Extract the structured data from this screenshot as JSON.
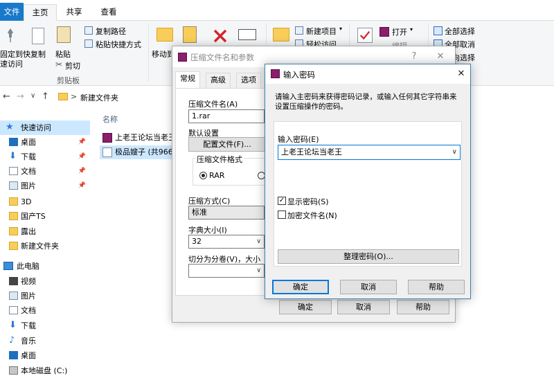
{
  "ribbon_tabs": {
    "file": "文件",
    "home": "主页",
    "share": "共享",
    "view": "查看"
  },
  "ribbon": {
    "pin_quick_access_line1": "固定到快",
    "pin_quick_access_line2": "速访问",
    "copy": "复制",
    "paste": "粘贴",
    "copy_path": "复制路径",
    "paste_shortcut": "粘贴快捷方式",
    "cut": "剪切",
    "clipboard_group": "剪贴板",
    "move_to": "移动到",
    "new_item": "新建项目",
    "easy_access": "轻松访问",
    "open": "打开",
    "edit": "编辑",
    "select_all": "全部选择",
    "select_none": "全部取消",
    "invert_selection": "反向选择"
  },
  "address": {
    "back": "←",
    "forward": "→",
    "dropdown": "∨",
    "up": "↑",
    "separator": ">",
    "path": "新建文件夹"
  },
  "nav": {
    "quick_access": "快速访问",
    "items": [
      {
        "label": "桌面"
      },
      {
        "label": "下载"
      },
      {
        "label": "文档"
      },
      {
        "label": "图片"
      },
      {
        "label": "3D"
      },
      {
        "label": "国产TS"
      },
      {
        "label": "露出"
      },
      {
        "label": "新建文件夹"
      }
    ],
    "this_pc": "此电脑",
    "pc_items": [
      {
        "label": "视频"
      },
      {
        "label": "图片"
      },
      {
        "label": "文档"
      },
      {
        "label": "下载"
      },
      {
        "label": "音乐"
      },
      {
        "label": "桌面"
      },
      {
        "label": "本地磁盘 (C:)"
      }
    ]
  },
  "files": {
    "column_name": "名称",
    "rows": [
      {
        "name": "上老王论坛当老王"
      },
      {
        "name": "极品嫂子 (共9663"
      }
    ]
  },
  "archive_dialog": {
    "title": "压缩文件名和参数",
    "help_icon": "?",
    "close_icon": "✕",
    "tabs": [
      "常规",
      "高级",
      "选项"
    ],
    "archive_name_label": "压缩文件名(A)",
    "archive_name_value": "1.rar",
    "default_settings_label": "默认设置",
    "profiles_button": "配置文件(F)...",
    "format_label": "压缩文件格式",
    "format_rar": "RAR",
    "method_label": "压缩方式(C)",
    "method_value": "标准",
    "dict_label": "字典大小(I)",
    "dict_value": "32",
    "split_label": "切分为分卷(V)，大小",
    "ok": "确定",
    "cancel": "取消",
    "help": "帮助"
  },
  "password_dialog": {
    "title": "输入密码",
    "close_icon": "✕",
    "description": "请输入主密码来获得密码记录，或输入任何其它字符串来设置压缩操作的密码。",
    "password_label": "输入密码(E)",
    "password_value": "上老王论坛当老王",
    "show_password": "显示密码(S)",
    "encrypt_names": "加密文件名(N)",
    "organize_button": "整理密码(O)...",
    "ok": "确定",
    "cancel": "取消",
    "help": "帮助",
    "show_password_checked": true,
    "encrypt_names_checked": false
  },
  "colors": {
    "accent": "#0078d7",
    "file_tab": "#1979ca",
    "selection": "#cce8ff"
  }
}
